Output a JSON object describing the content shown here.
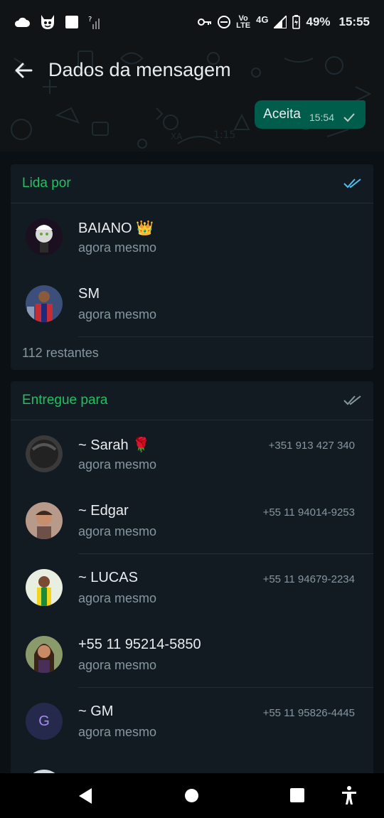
{
  "status_bar": {
    "lte_top": "Vo",
    "lte_bottom": "LTE",
    "network": "4G",
    "battery": "49%",
    "time": "15:55"
  },
  "header": {
    "title": "Dados da mensagem",
    "message": {
      "text": "Aceita",
      "time": "15:54"
    }
  },
  "read_by": {
    "title": "Lida por",
    "contacts": [
      {
        "name": "BAIANO 👑",
        "time": "agora mesmo"
      },
      {
        "name": "SM",
        "time": "agora mesmo"
      }
    ],
    "remaining": "112 restantes"
  },
  "delivered_to": {
    "title": "Entregue para",
    "contacts": [
      {
        "name": "~ Sarah 🌹",
        "time": "agora mesmo",
        "phone": "+351 913 427 340"
      },
      {
        "name": "~ Edgar",
        "time": "agora mesmo",
        "phone": "+55 11 94014-9253"
      },
      {
        "name": "~ LUCAS",
        "time": "agora mesmo",
        "phone": "+55 11 94679-2234"
      },
      {
        "name": "+55 11 95214-5850",
        "time": "agora mesmo",
        "phone": ""
      },
      {
        "name": "~ GM",
        "time": "agora mesmo",
        "phone": "+55 11 95826-4445",
        "avatar_letter": "G"
      }
    ]
  },
  "colors": {
    "accent": "#21c063",
    "read_tick": "#53bdeb",
    "bubble": "#005c4b",
    "card": "#121b22"
  }
}
